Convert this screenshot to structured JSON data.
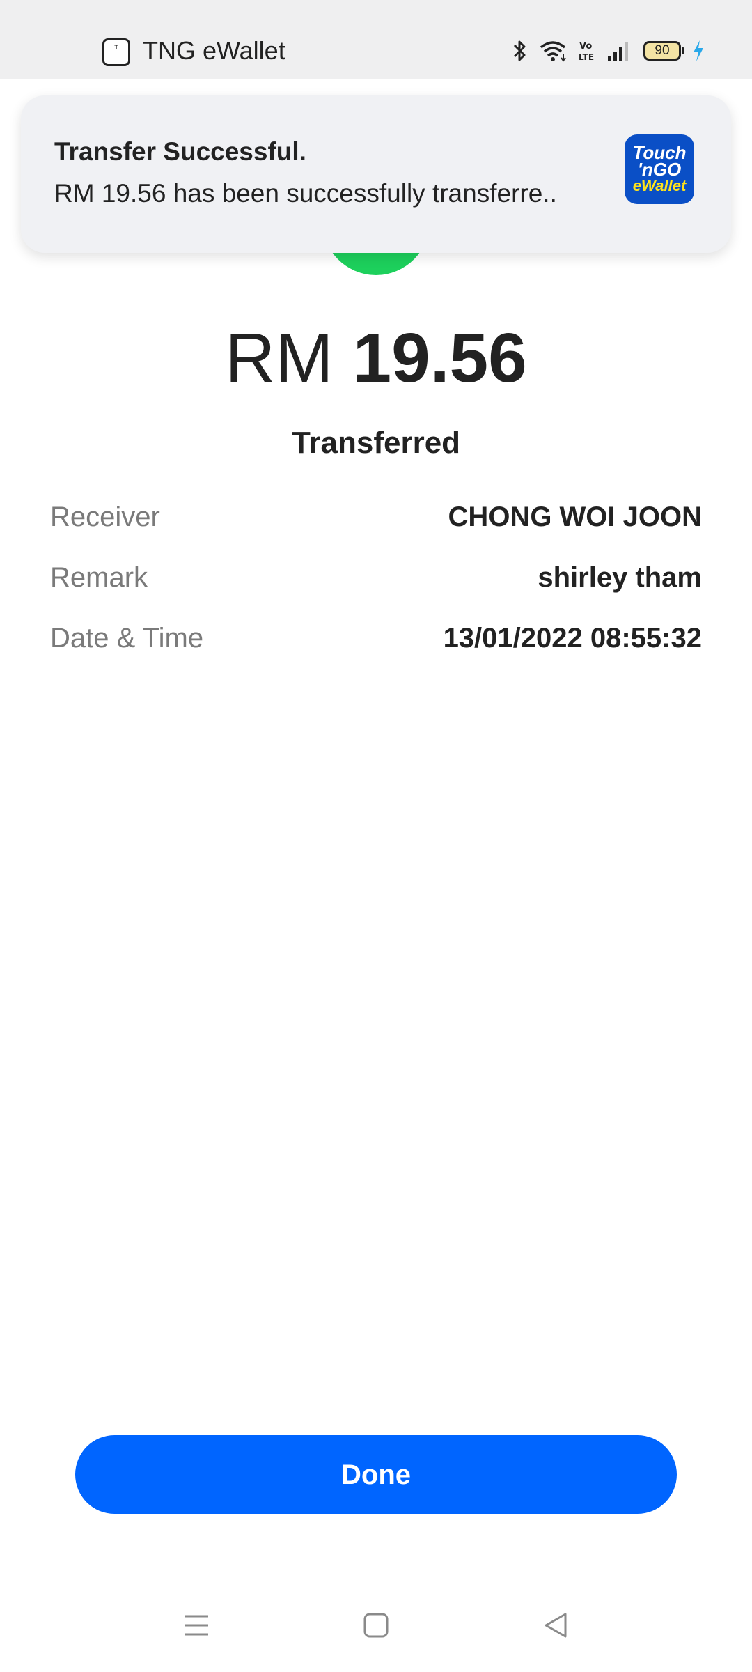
{
  "status_bar": {
    "app_icon_text": "Touch n'GO eWallet",
    "app_name": "TNG eWallet",
    "network_label": "Vo LTE",
    "battery_level": "90",
    "icons": [
      "bluetooth-icon",
      "wifi-icon",
      "volte-icon",
      "signal-icon",
      "battery-icon",
      "charging-icon"
    ]
  },
  "notification": {
    "title": "Transfer Successful.",
    "body": "RM 19.56 has been successfully transferre..",
    "logo_line1": "Touch",
    "logo_line2": "'nGO",
    "logo_line3": "eWallet",
    "logo_colors": {
      "background": "#0a4fc6",
      "accent": "#ffe21a"
    }
  },
  "success_indicator_color": "#1dd05c",
  "transaction": {
    "currency": "RM",
    "amount": "19.56",
    "status": "Transferred",
    "details": [
      {
        "label": "Receiver",
        "value": "CHONG WOI JOON"
      },
      {
        "label": "Remark",
        "value": "shirley tham"
      },
      {
        "label": "Date & Time",
        "value": "13/01/2022 08:55:32"
      }
    ]
  },
  "actions": {
    "done_label": "Done",
    "primary_color": "#0065ff"
  },
  "nav_bar": {
    "icons": [
      "menu-icon",
      "home-icon",
      "back-icon"
    ]
  }
}
